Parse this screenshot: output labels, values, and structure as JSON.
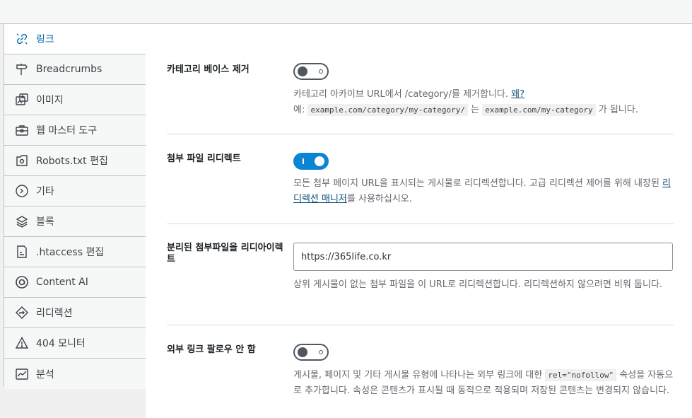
{
  "sidebar": {
    "items": [
      {
        "label": "링크",
        "icon": "link-icon"
      },
      {
        "label": "Breadcrumbs",
        "icon": "signpost-icon"
      },
      {
        "label": "이미지",
        "icon": "image-icon"
      },
      {
        "label": "웹 마스터 도구",
        "icon": "toolbox-icon"
      },
      {
        "label": "Robots.txt 편집",
        "icon": "robots-file-icon"
      },
      {
        "label": "기타",
        "icon": "misc-icon"
      },
      {
        "label": "블록",
        "icon": "blocks-icon"
      },
      {
        "label": ".htaccess 편집",
        "icon": "htaccess-file-icon"
      },
      {
        "label": "Content AI",
        "icon": "content-ai-icon"
      },
      {
        "label": "리디렉션",
        "icon": "redirect-icon"
      },
      {
        "label": "404 모니터",
        "icon": "warning-icon"
      },
      {
        "label": "분석",
        "icon": "analytics-icon"
      }
    ]
  },
  "settings": {
    "strip_category": {
      "label": "카테고리 베이스 제거",
      "enabled": false,
      "desc_prefix": "카테고리 아카이브 URL에서 /category/를 제거합니다. ",
      "desc_link": "왜?",
      "example_prefix": "예: ",
      "example_from": "example.com/category/my-category/",
      "example_mid": " 는 ",
      "example_to": "example.com/my-category",
      "example_suffix": " 가 됩니다."
    },
    "attachment_redirect": {
      "label": "첨부 파일 리디렉트",
      "enabled": true,
      "desc_prefix": "모든 첨부 페이지 URL을 표시되는 게시물로 리디렉션합니다. 고급 리디렉션 제어를 위해 내장된 ",
      "desc_link": "리디렉션 매니저",
      "desc_suffix": "를 사용하십시오."
    },
    "orphan_redirect": {
      "label": "분리된 첨부파일을 리디아이렉트",
      "value": "https://365life.co.kr",
      "desc": "상위 게시물이 없는 첨부 파일을 이 URL로 리디렉션합니다. 리디렉션하지 않으려면 비워 둡니다."
    },
    "nofollow_external": {
      "label": "외부 링크 팔로우 안 함",
      "enabled": false,
      "desc_prefix": "게시물, 페이지 및 기타 게시물 유형에 나타나는 외부 링크에 대한 ",
      "desc_code": "rel=\"nofollow\"",
      "desc_suffix": " 속성을 자동으로 추가합니다. 속성은 콘텐츠가 표시될 때 동적으로 적용되며 저장된 콘텐츠는 변경되지 않습니다."
    }
  },
  "colors": {
    "accent": "#0a85d1",
    "active_text": "#0a6aa5",
    "link": "#0a4b78"
  }
}
